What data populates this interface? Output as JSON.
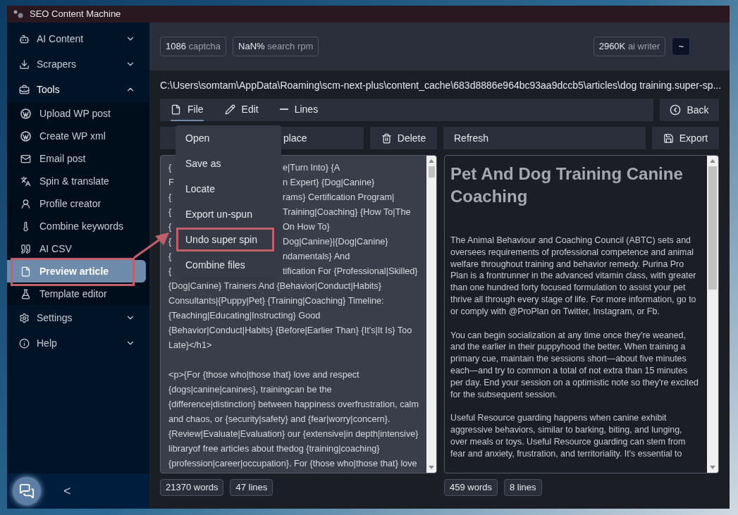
{
  "window": {
    "title": "SEO Content Machine"
  },
  "sidebar": {
    "sections": [
      {
        "label": "AI Content",
        "expanded": false
      },
      {
        "label": "Scrapers",
        "expanded": false
      },
      {
        "label": "Tools",
        "expanded": true,
        "children": [
          {
            "label": "Upload WP post",
            "selected": false,
            "annotated": false
          },
          {
            "label": "Create WP xml",
            "selected": false,
            "annotated": false
          },
          {
            "label": "Email post",
            "selected": false,
            "annotated": false
          },
          {
            "label": "Spin & translate",
            "selected": false,
            "annotated": false
          },
          {
            "label": "Profile creator",
            "selected": false,
            "annotated": false
          },
          {
            "label": "Combine keywords",
            "selected": false,
            "annotated": false
          },
          {
            "label": "AI CSV",
            "selected": false,
            "annotated": false
          },
          {
            "label": "Preview article",
            "selected": true,
            "annotated": true
          },
          {
            "label": "Template editor",
            "selected": false,
            "annotated": false
          }
        ]
      },
      {
        "label": "Settings",
        "expanded": false
      },
      {
        "label": "Help",
        "expanded": false
      }
    ],
    "collapse": "<"
  },
  "stats": {
    "left": [
      {
        "value": "1086",
        "label": "captcha"
      },
      {
        "value": "NaN%",
        "label": "search rpm"
      }
    ],
    "right": [
      {
        "value": "2960K",
        "label": "ai writer"
      }
    ],
    "toggle": "~"
  },
  "path": "C:\\Users\\somtam\\AppData\\Roaming\\scm-next-plus\\content_cache\\683d8886e964bc93aa9dccb5\\articles\\dog training.super-sp...",
  "tabs": [
    {
      "label": "File",
      "selected": true
    },
    {
      "label": "Edit",
      "selected": false
    },
    {
      "label": "Lines",
      "selected": false
    }
  ],
  "back": "Back",
  "actions": [
    "place",
    "Delete"
  ],
  "refresh": "Refresh",
  "export": "Export",
  "menu": [
    {
      "label": "Open",
      "annotated": false
    },
    {
      "label": "Save as",
      "annotated": false
    },
    {
      "label": "Locate",
      "annotated": false
    },
    {
      "label": "Export un-spun",
      "annotated": false
    },
    {
      "label": "Undo super spin",
      "annotated": true
    },
    {
      "label": "Combine files",
      "annotated": false
    }
  ],
  "source": {
    "covered_lines": [
      {
        "left": "{",
        "right": "e|Turn Into} {A"
      },
      {
        "left": "F",
        "right": "n Expert} {Dog|Canine}"
      },
      {
        "left": "{",
        "right": "rams} Certification Program|"
      },
      {
        "left": "{",
        "right": "Training|Coaching} {How To|The"
      },
      {
        "left": "{",
        "right": "On How To}"
      },
      {
        "left": "{",
        "right": "Dog|Canine}|{Dog|Canine}"
      },
      {
        "left": "{",
        "right": "ndamentals} And"
      },
      {
        "left": "{",
        "right": "tification For {Professional|Skilled}"
      }
    ],
    "heading_lines": [
      "{Dog|Canine} Trainers And {Behavior|Conduct|Habits}",
      "Consultants|{Puppy|Pet} {Training|Coaching} Timeline:",
      "{Teaching|Educating|Instructing} Good",
      "{Behavior|Conduct|Habits} {Before|Earlier Than} {It's|It Is} Too",
      "Late}</h1>"
    ],
    "paragraph_lines": [
      "<p>{For {those who|those that} love and respect",
      "{dogs|canine|canines}, trainingcan be the",
      "{difference|distinction} between happiness overfrustration, calm",
      "and chaos, or {security|safety} and {fear|worry|concern}.",
      "{Review|Evaluate|Evaluation} our {extensive|in depth|intensive}",
      "libraryof free articles about thedog {training|coaching}",
      "{profession|career|occupation}. For {those who|those that} love"
    ],
    "counts": [
      "21370 words",
      "47 lines"
    ]
  },
  "preview": {
    "title": "Pet And Dog Training Canine Coaching",
    "paragraphs": [
      "The Animal Behaviour and Coaching Council (ABTC) sets and oversees requirements of professional competence and animal welfare throughout training and behavior remedy. Purina Pro Plan is a frontrunner in the advanced vitamin class, with greater than one hundred forty focused formulation to assist your pet thrive all through every stage of life. For more information, go to  or comply with @ProPlan on Twitter, Instagram, or Fb.",
      "You can begin socialization at any time  once they're weaned, and the earlier in their puppyhood the better. When training a primary cue, maintain the sessions short—about five minutes each—and try to common a total of not extra than 15 minutes per day. End your session on a optimistic note so they're excited for the subsequent session.",
      "Useful Resource guarding happens when canine exhibit aggressive behaviors, similar to barking, biting, and lunging, over meals or toys. Useful Resource guarding can stem from fear and anxiety, frustration, and territoriality. It's essential to"
    ],
    "counts": [
      "459 words",
      "8 lines"
    ]
  }
}
